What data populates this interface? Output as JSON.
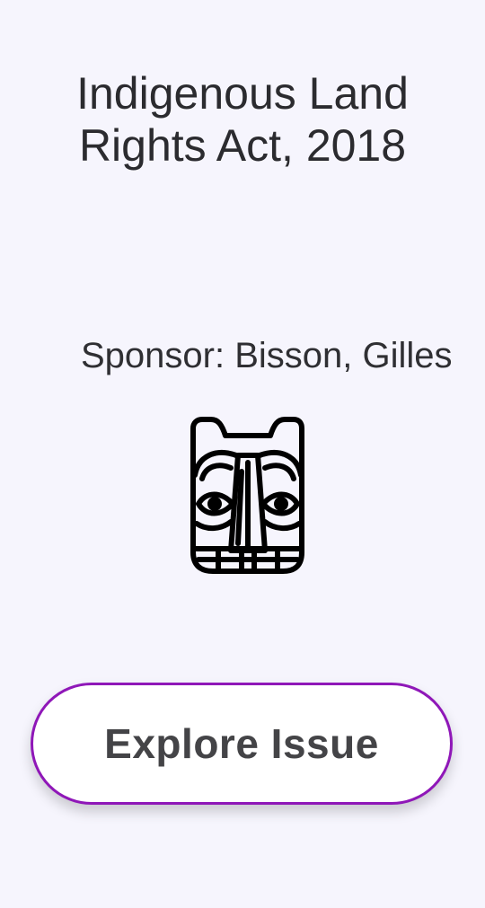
{
  "title": {
    "line1": "Indigenous Land",
    "line2": "Rights Act, 2018"
  },
  "sponsor": "Sponsor: Bisson, Gilles",
  "icon": "indigenous-mask-icon",
  "button": {
    "label": "Explore Issue",
    "border_color": "#8f17b8"
  },
  "colors": {
    "background": "#f6f5fd"
  }
}
